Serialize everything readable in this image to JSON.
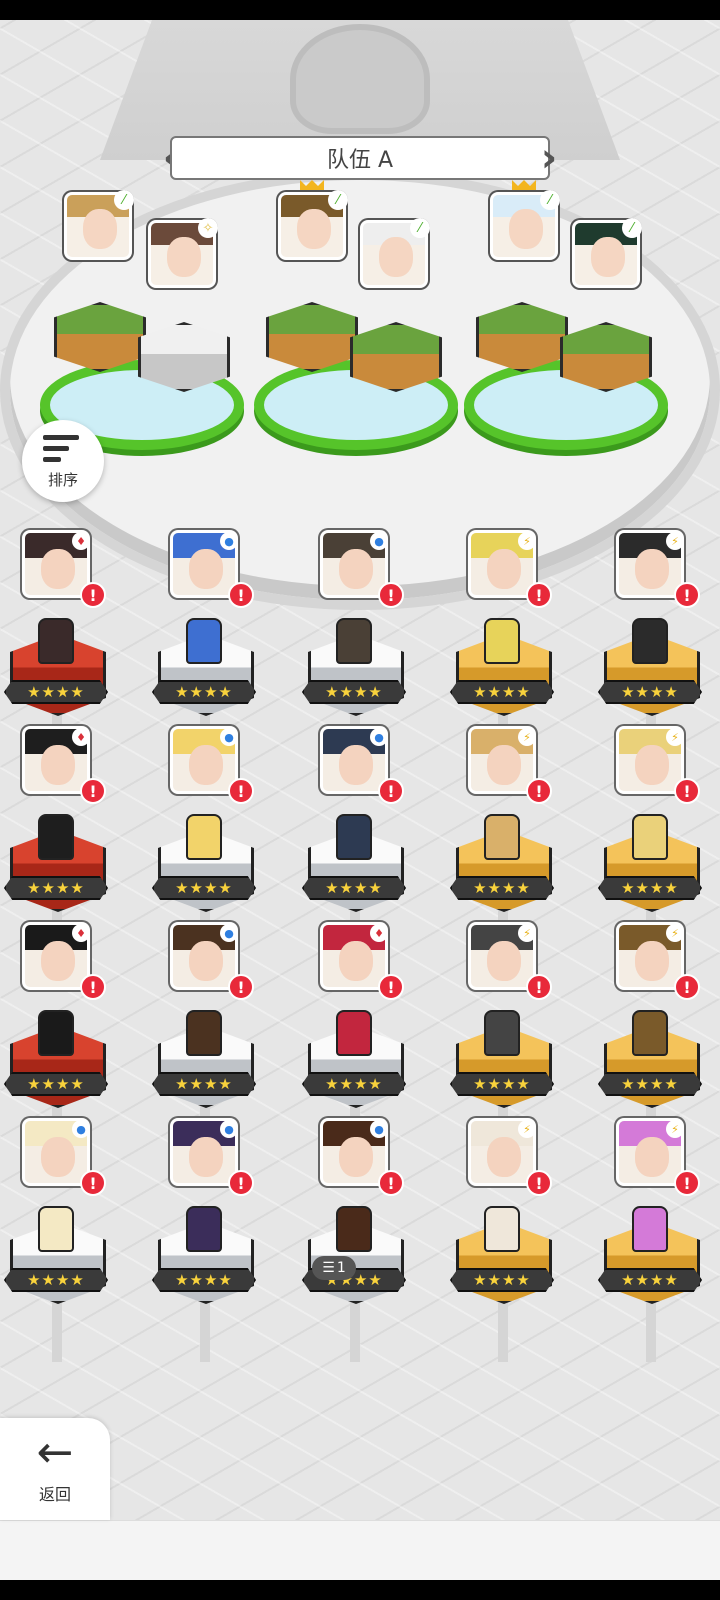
{
  "team": {
    "title": "队伍 A"
  },
  "sort": {
    "label": "排序"
  },
  "back": {
    "label": "返回"
  },
  "filter_chip": {
    "count": "1"
  },
  "colors": {
    "grass": "#56c42a",
    "alert": "#e8293a",
    "gold_star": "#f8d23c"
  },
  "team_slots": [
    {
      "element": "leaf",
      "hair": "#caa05a"
    },
    {
      "element": "light",
      "hair": "#6b4a3a"
    },
    {
      "element": "leaf",
      "hair": "#7a5a2a",
      "leader": true
    },
    {
      "element": "leaf",
      "hair": "#eeeeee"
    },
    {
      "element": "leaf",
      "hair": "#d9ecf8",
      "leader": true
    },
    {
      "element": "leaf",
      "hair": "#1f3b2e"
    }
  ],
  "heroes": [
    {
      "stars": "★★★★",
      "element": "fire",
      "ped": "red",
      "hair": "#3a2a2a"
    },
    {
      "stars": "★★★★",
      "element": "water",
      "ped": "silver",
      "hair": "#3e6fd1"
    },
    {
      "stars": "★★★★",
      "element": "water",
      "ped": "silver",
      "hair": "#4a4036"
    },
    {
      "stars": "★★★★",
      "element": "lightning",
      "ped": "gold",
      "hair": "#e7d35a"
    },
    {
      "stars": "★★★★",
      "element": "lightning",
      "ped": "gold",
      "hair": "#2b2b2b"
    },
    {
      "stars": "★★★★",
      "element": "fire",
      "ped": "red",
      "hair": "#1e1e1e"
    },
    {
      "stars": "★★★★",
      "element": "water",
      "ped": "silver",
      "hair": "#f2d36a"
    },
    {
      "stars": "★★★★",
      "element": "water",
      "ped": "silver",
      "hair": "#2d3a52"
    },
    {
      "stars": "★★★★",
      "element": "lightning",
      "ped": "gold",
      "hair": "#d9b06a"
    },
    {
      "stars": "★★★★",
      "element": "lightning",
      "ped": "gold",
      "hair": "#ead17a"
    },
    {
      "stars": "★★★★",
      "element": "fire",
      "ped": "red",
      "hair": "#1a1a1a"
    },
    {
      "stars": "★★★★",
      "element": "water",
      "ped": "silver",
      "hair": "#4b3220"
    },
    {
      "stars": "★★★★",
      "element": "fire",
      "ped": "silver",
      "hair": "#c2263e"
    },
    {
      "stars": "★★★★",
      "element": "lightning",
      "ped": "gold",
      "hair": "#444444"
    },
    {
      "stars": "★★★★",
      "element": "lightning",
      "ped": "gold",
      "hair": "#7a5a2a"
    },
    {
      "stars": "★★★★",
      "element": "water",
      "ped": "silver",
      "hair": "#f4e9c4"
    },
    {
      "stars": "★★★★",
      "element": "water",
      "ped": "silver",
      "hair": "#3b2d5a"
    },
    {
      "stars": "★★★★",
      "element": "water",
      "ped": "silver",
      "hair": "#4a2a1a"
    },
    {
      "stars": "★★★★",
      "element": "lightning",
      "ped": "gold",
      "hair": "#efe7da"
    },
    {
      "stars": "★★★★",
      "element": "lightning",
      "ped": "gold",
      "hair": "#d47ad8"
    }
  ]
}
